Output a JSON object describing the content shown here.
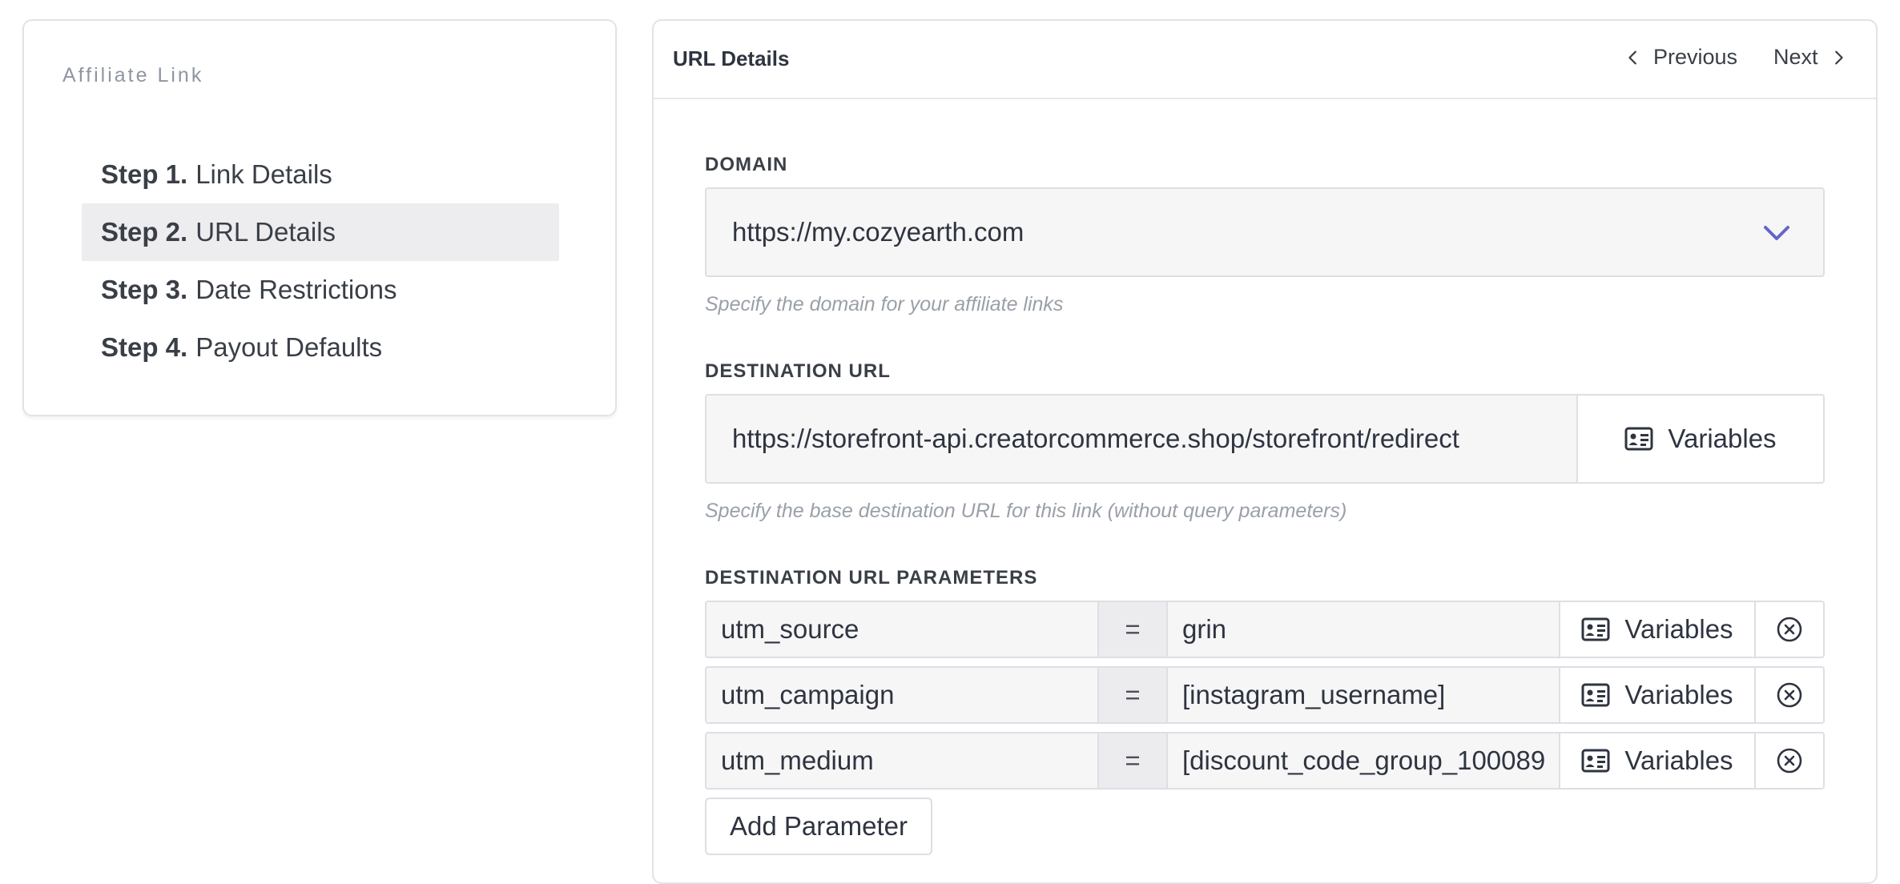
{
  "sidebar": {
    "title": "Affiliate Link",
    "steps": [
      {
        "num": "Step 1.",
        "label": "Link Details"
      },
      {
        "num": "Step 2.",
        "label": "URL Details"
      },
      {
        "num": "Step 3.",
        "label": "Date Restrictions"
      },
      {
        "num": "Step 4.",
        "label": "Payout Defaults"
      }
    ],
    "active_step": 2
  },
  "header": {
    "title": "URL Details",
    "previous_label": "Previous",
    "next_label": "Next"
  },
  "domain": {
    "label": "DOMAIN",
    "value": "https://my.cozyearth.com",
    "help": "Specify the domain for your affiliate links",
    "chevron_icon": "chevron-down-icon",
    "chevron_color": "#6366c9"
  },
  "destination": {
    "label": "DESTINATION URL",
    "value": "https://storefront-api.creatorcommerce.shop/storefront/redirect",
    "variables_label": "Variables",
    "help": "Specify the base destination URL for this link (without query parameters)"
  },
  "parameters": {
    "label": "DESTINATION URL PARAMETERS",
    "equals": "=",
    "variables_label": "Variables",
    "rows": [
      {
        "key": "utm_source",
        "value": "grin"
      },
      {
        "key": "utm_campaign",
        "value": "[instagram_username]"
      },
      {
        "key": "utm_medium",
        "value": "[discount_code_group_100089"
      }
    ],
    "add_label": "Add Parameter"
  }
}
